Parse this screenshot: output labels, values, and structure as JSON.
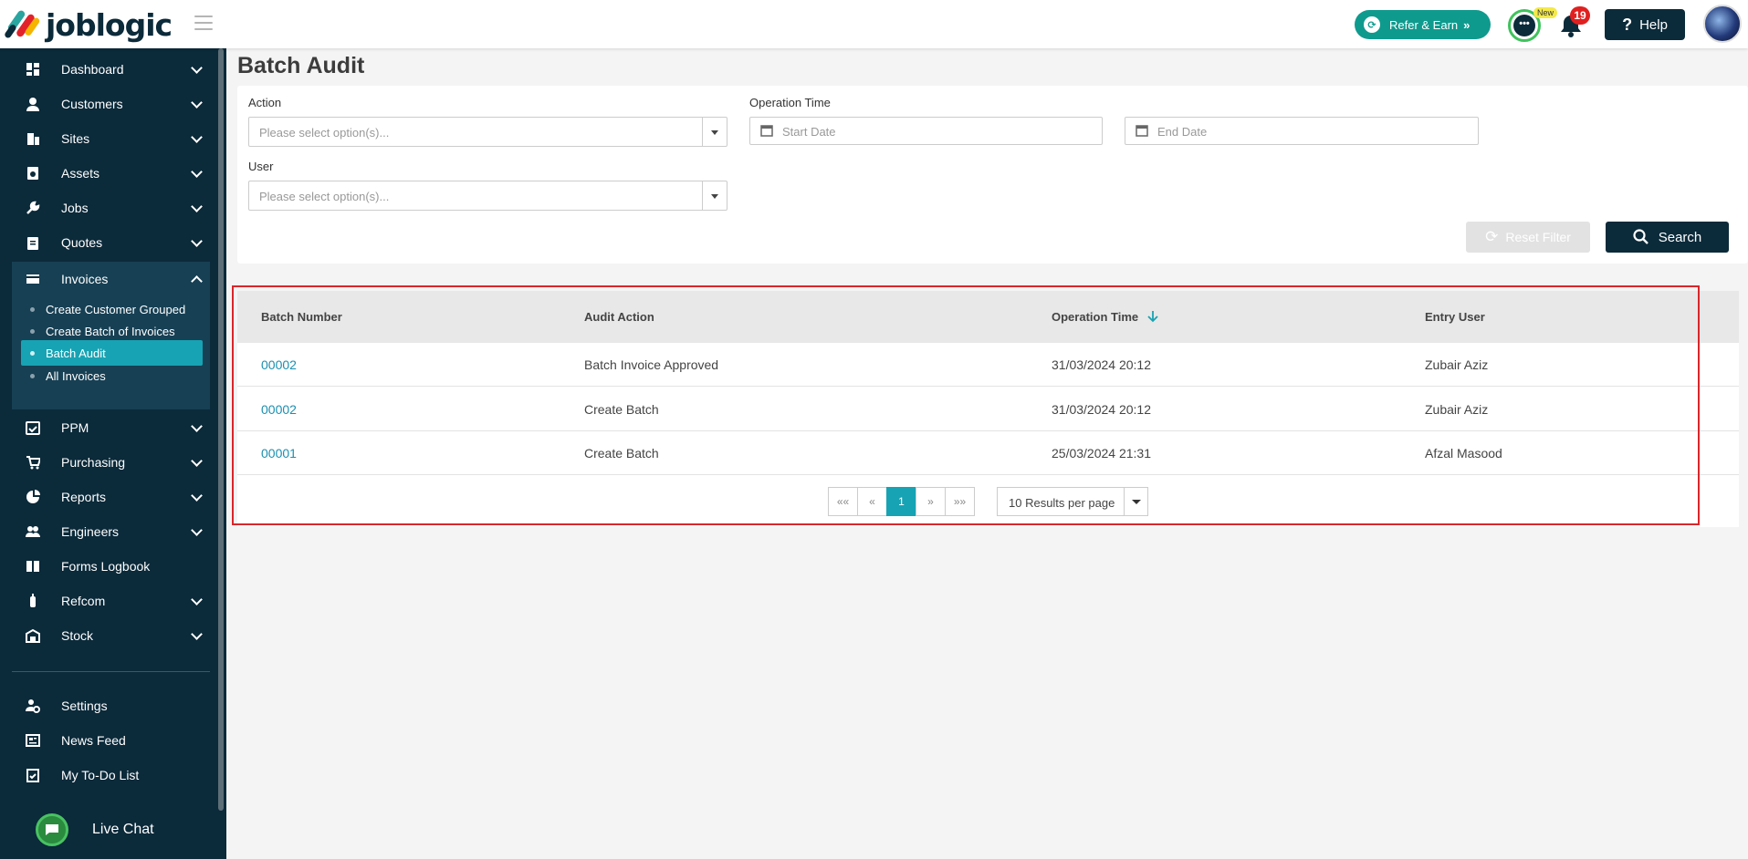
{
  "brand": {
    "name": "joblogic"
  },
  "header": {
    "refer_label": "Refer & Earn",
    "new_badge": "New",
    "notifications_count": "19",
    "help_label": "Help"
  },
  "sidebar": {
    "items": [
      {
        "label": "Dashboard",
        "icon": "dashboard-icon"
      },
      {
        "label": "Customers",
        "icon": "person-icon"
      },
      {
        "label": "Sites",
        "icon": "building-icon"
      },
      {
        "label": "Assets",
        "icon": "asset-icon"
      },
      {
        "label": "Jobs",
        "icon": "wrench-icon"
      },
      {
        "label": "Quotes",
        "icon": "clipboard-icon"
      },
      {
        "label": "Invoices",
        "icon": "invoice-icon"
      },
      {
        "label": "PPM",
        "icon": "calendar-check-icon"
      },
      {
        "label": "Purchasing",
        "icon": "cart-icon"
      },
      {
        "label": "Reports",
        "icon": "pie-chart-icon"
      },
      {
        "label": "Engineers",
        "icon": "people-icon"
      },
      {
        "label": "Forms Logbook",
        "icon": "book-icon"
      },
      {
        "label": "Refcom",
        "icon": "cylinder-icon"
      },
      {
        "label": "Stock",
        "icon": "warehouse-icon"
      }
    ],
    "invoice_subitems": [
      "Create Customer Grouped",
      "Create Batch of Invoices",
      "Batch Audit",
      "All Invoices"
    ],
    "bottom_items": [
      {
        "label": "Settings",
        "icon": "user-gear-icon"
      },
      {
        "label": "News Feed",
        "icon": "newspaper-icon"
      },
      {
        "label": "My To-Do List",
        "icon": "todo-icon"
      }
    ],
    "live_chat": "Live Chat"
  },
  "page": {
    "title": "Batch Audit"
  },
  "filters": {
    "action_label": "Action",
    "action_placeholder": "Please select option(s)...",
    "operation_time_label": "Operation Time",
    "start_placeholder": "Start Date",
    "end_placeholder": "End Date",
    "user_label": "User",
    "user_placeholder": "Please select option(s)...",
    "reset_label": "Reset Filter",
    "search_label": "Search"
  },
  "table": {
    "headers": [
      "Batch Number",
      "Audit Action",
      "Operation Time",
      "Entry User"
    ],
    "rows": [
      [
        "00002",
        "Batch Invoice Approved",
        "31/03/2024 20:12",
        "Zubair Aziz"
      ],
      [
        "00002",
        "Create Batch",
        "31/03/2024 20:12",
        "Zubair Aziz"
      ],
      [
        "00001",
        "Create Batch",
        "25/03/2024 21:31",
        "Afzal Masood"
      ]
    ]
  },
  "pagination": {
    "first": "««",
    "prev": "«",
    "current": "1",
    "next": "»",
    "last": "»»",
    "per_page": "10 Results per page"
  },
  "colors": {
    "sidebar": "#0b2a3a",
    "accent": "#17a3b3",
    "refer": "#0f9a8e",
    "highlight": "#d9262b"
  }
}
